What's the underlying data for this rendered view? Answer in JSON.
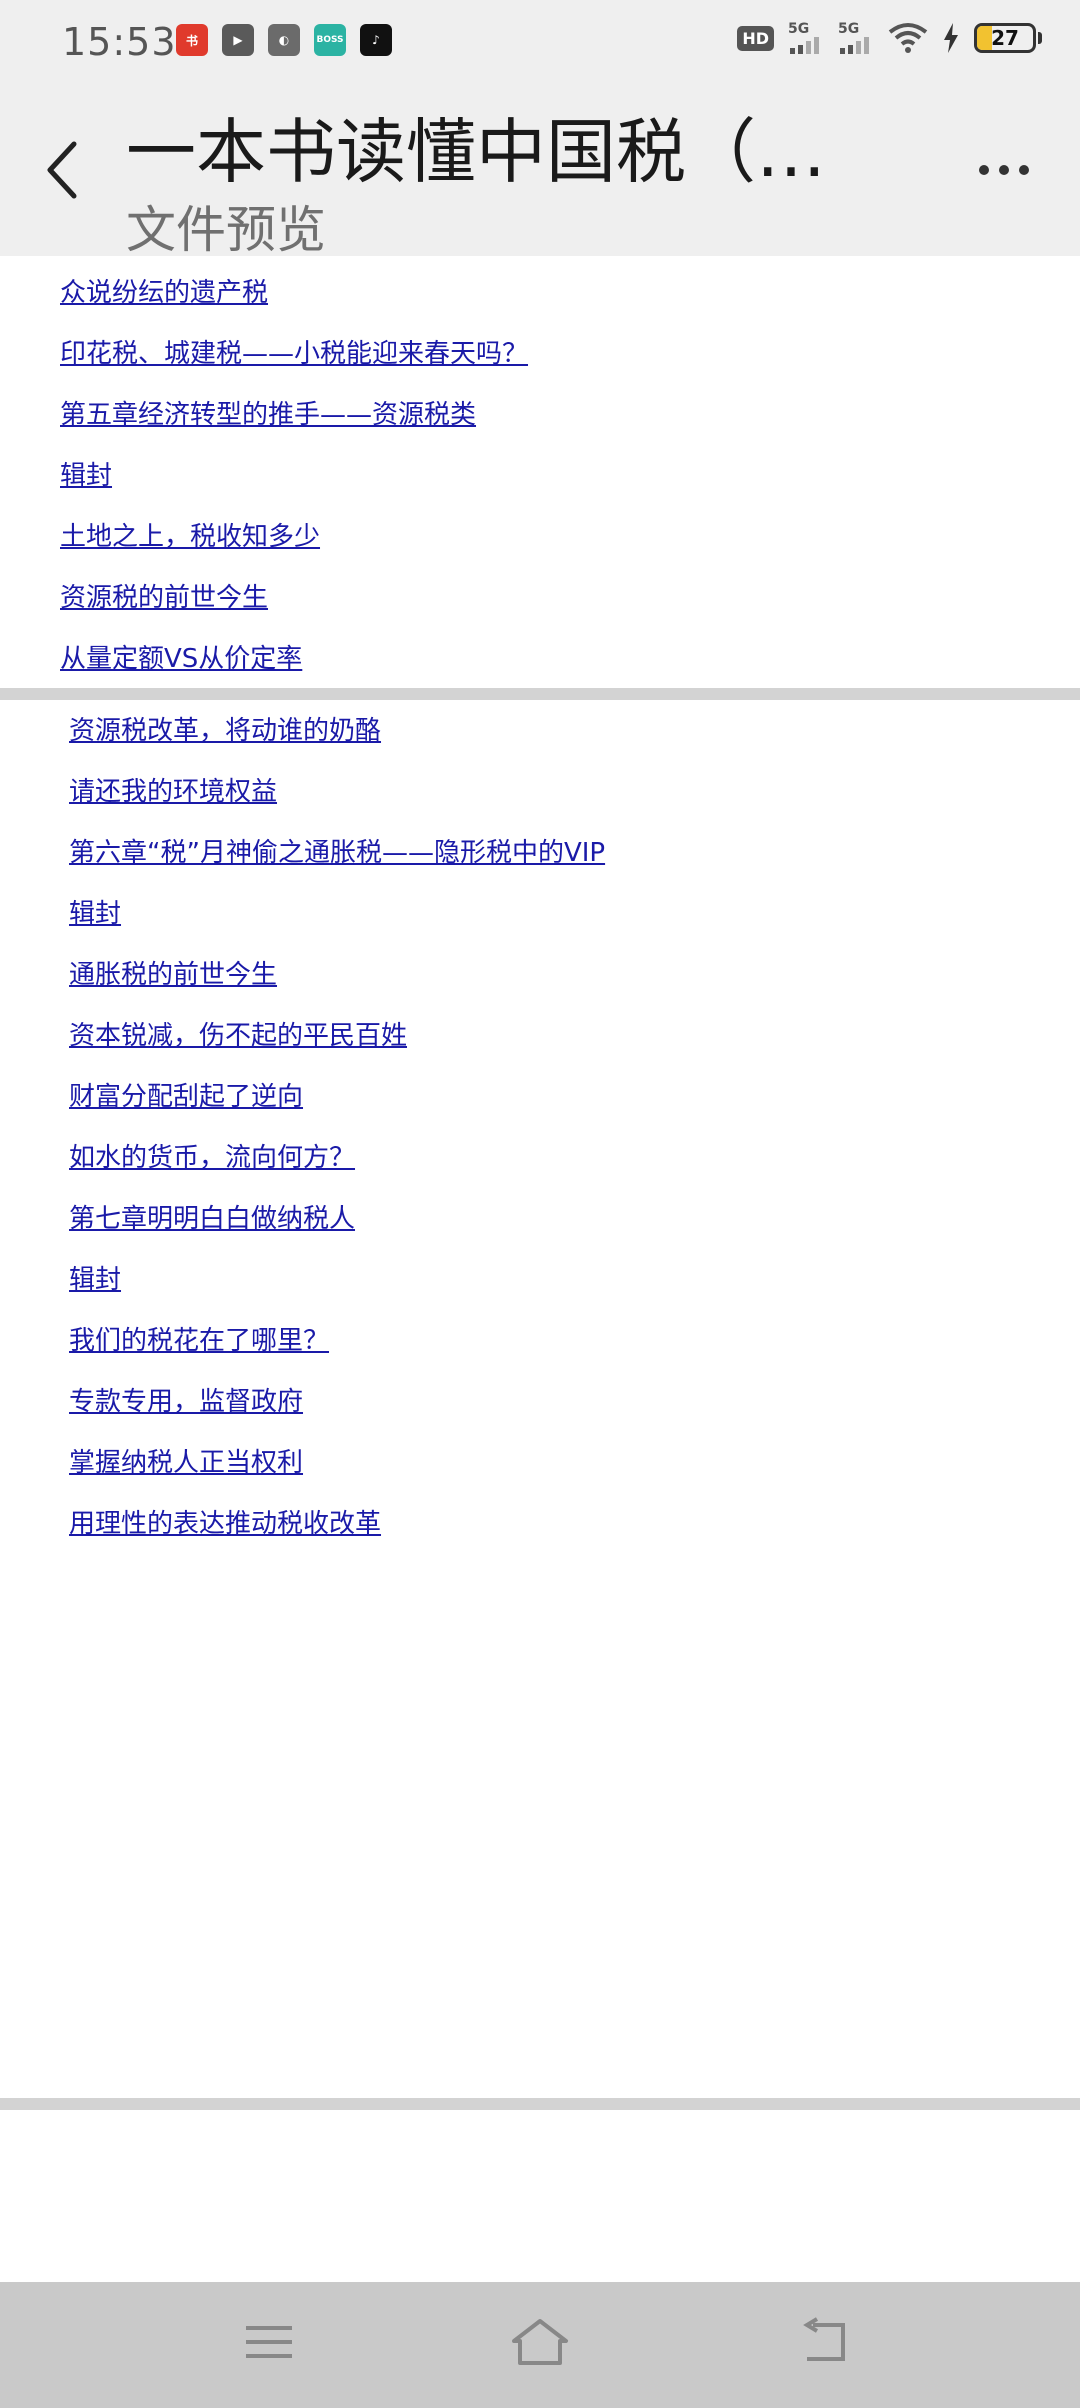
{
  "status_bar": {
    "time": "15:53",
    "app_icons": [
      {
        "name": "app-icon-red",
        "color": "#e03a2c",
        "glyph": "书"
      },
      {
        "name": "app-icon-video",
        "color": "#5a5a5a",
        "glyph": "▶"
      },
      {
        "name": "app-icon-planet",
        "color": "#6b6b6b",
        "glyph": "◐"
      },
      {
        "name": "app-icon-boss",
        "color": "#2bb3a3",
        "glyph": "BOSS"
      },
      {
        "name": "app-icon-tiktok",
        "color": "#111111",
        "glyph": "♪"
      }
    ],
    "hd_label": "HD",
    "sim_label_1": "5G",
    "sim_label_2": "5G",
    "battery_level": "27",
    "battery_fraction": 0.27
  },
  "header": {
    "title": "一本书读懂中国税（…",
    "subtitle": "文件预览"
  },
  "section1": {
    "links": [
      "众说纷纭的遗产税",
      "印花税、城建税——小税能迎来春天吗？",
      "第五章经济转型的推手——资源税类",
      "辑封",
      "土地之上，税收知多少",
      "资源税的前世今生",
      "从量定额VS从价定率"
    ]
  },
  "section2": {
    "links": [
      "资源税改革，将动谁的奶酪",
      "请还我的环境权益",
      "第六章“税”月神偷之通胀税——隐形税中的VIP",
      "辑封",
      "通胀税的前世今生",
      "资本锐减，伤不起的平民百姓",
      "财富分配刮起了逆向",
      "如水的货币，流向何方？",
      "第七章明明白白做纳税人",
      "辑封",
      "我们的税花在了哪里？",
      "专款专用，监督政府",
      "掌握纳税人正当权利",
      "用理性的表达推动税收改革"
    ]
  },
  "colors": {
    "link": "#1a1aa8",
    "topbar_bg": "#efefef",
    "navbar_bg": "#c9c9c9",
    "divider": "#d3d3d3"
  }
}
